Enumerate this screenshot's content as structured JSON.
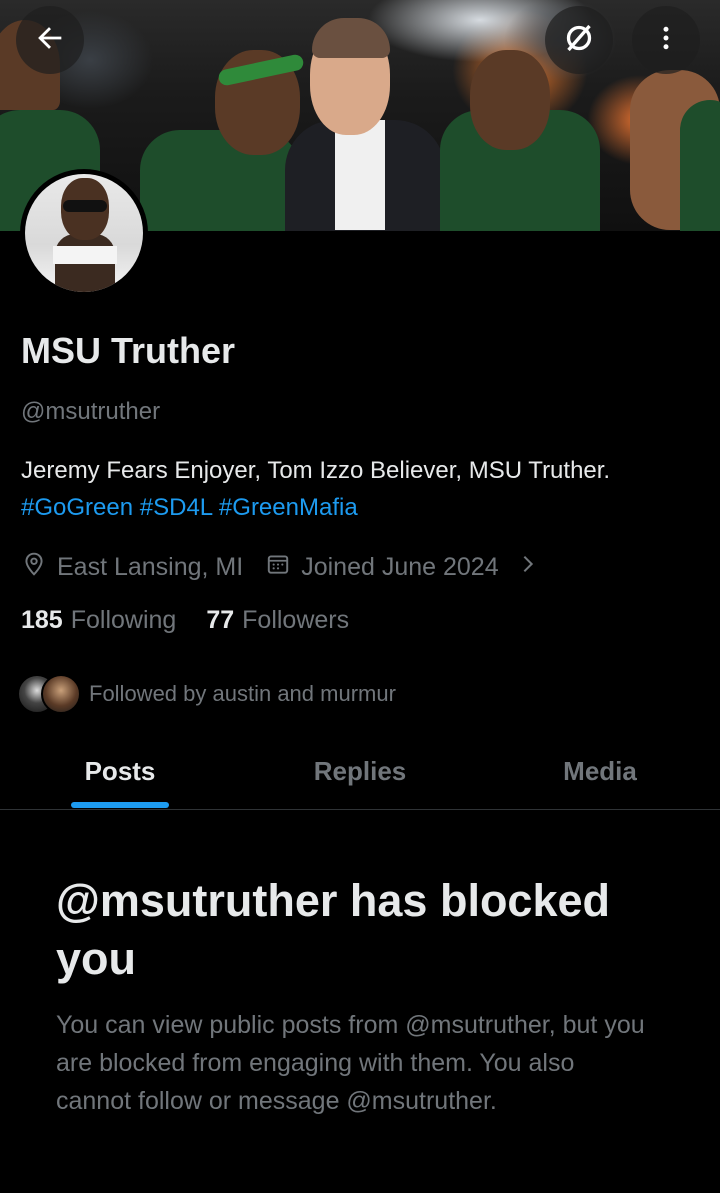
{
  "header": {
    "back_icon": "arrow-left-icon",
    "tracking_icon": "slashed-circle-icon",
    "more_icon": "more-vertical-icon"
  },
  "profile": {
    "display_name": "MSU Truther",
    "handle": "@msutruther",
    "bio_text": "Jeremy Fears Enjoyer, Tom Izzo Believer, MSU Truther.",
    "bio_tags": [
      "#GoGreen",
      "#SD4L",
      "#GreenMafia"
    ],
    "location": "East Lansing, MI",
    "joined": "Joined June 2024",
    "following_count": "185",
    "following_label": "Following",
    "followers_count": "77",
    "followers_label": "Followers",
    "followed_by": "Followed by austin and murmur"
  },
  "tabs": [
    {
      "label": "Posts",
      "active": true
    },
    {
      "label": "Replies",
      "active": false
    },
    {
      "label": "Media",
      "active": false
    }
  ],
  "blocked": {
    "title": "@msutruther has blocked you",
    "description": "You can view public posts from @msutruther, but you are blocked from engaging with them. You also cannot follow or message @msutruther."
  },
  "colors": {
    "background": "#000000",
    "text_primary": "#e7e9ea",
    "text_secondary": "#71767b",
    "accent": "#1d9bf0",
    "jersey_green": "#1e4d2b"
  }
}
